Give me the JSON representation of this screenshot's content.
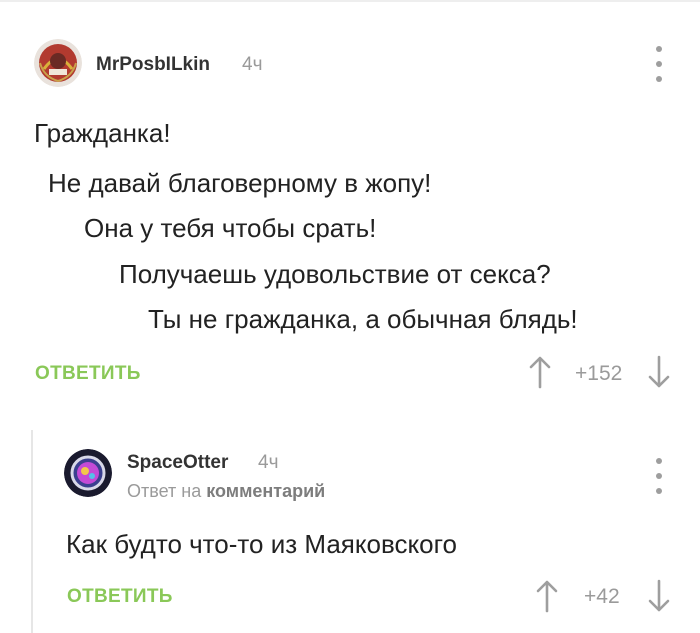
{
  "comments": [
    {
      "author": "MrPosbILkin",
      "time": "4ч",
      "lines": [
        "Гражданка!",
        "Не давай благоверному в жопу!",
        "Она у тебя чтобы срать!",
        "Получаешь удовольствие от секса?",
        "Ты не гражданка, а обычная блядь!"
      ],
      "reply_label": "ОТВЕТИТЬ",
      "rating": "+152"
    },
    {
      "author": "SpaceOtter",
      "time": "4ч",
      "reply_to_prefix": "Ответ на",
      "reply_to_target": "комментарий",
      "lines": [
        "Как будто что-то из Маяковского"
      ],
      "reply_label": "ОТВЕТИТЬ",
      "rating": "+42"
    }
  ],
  "colors": {
    "accent": "#8ac858",
    "muted": "#9a9a9a",
    "text": "#222222"
  },
  "icons": {
    "menu": "more-vertical-icon",
    "upvote": "arrow-up-icon",
    "downvote": "arrow-down-icon"
  }
}
